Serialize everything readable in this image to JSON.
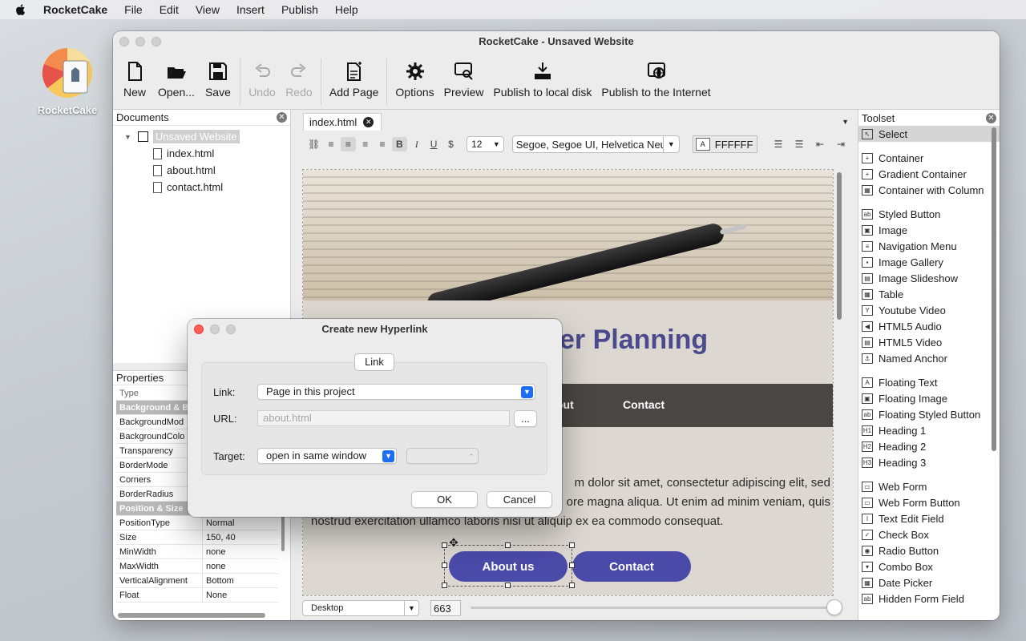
{
  "menubar": {
    "app_name": "RocketCake",
    "items": [
      "File",
      "Edit",
      "View",
      "Insert",
      "Publish",
      "Help"
    ]
  },
  "desktop_icon": {
    "label": "RocketCake"
  },
  "window": {
    "title": "RocketCake - Unsaved Website"
  },
  "toolbar": {
    "new": "New",
    "open": "Open...",
    "save": "Save",
    "undo": "Undo",
    "redo": "Redo",
    "add_page": "Add Page",
    "options": "Options",
    "preview": "Preview",
    "publish_local": "Publish to local disk",
    "publish_internet": "Publish to the Internet"
  },
  "documents": {
    "title": "Documents",
    "root": "Unsaved Website",
    "files": [
      "index.html",
      "about.html",
      "contact.html"
    ]
  },
  "properties": {
    "title": "Properties",
    "rows": [
      {
        "k": "Type",
        "v": "",
        "kind": "hdr"
      },
      {
        "k": "Background & Bo",
        "v": "",
        "kind": "group"
      },
      {
        "k": "BackgroundMod",
        "v": "",
        "kind": "row"
      },
      {
        "k": "BackgroundColo",
        "v": "",
        "kind": "row"
      },
      {
        "k": "Transparency",
        "v": "",
        "kind": "row"
      },
      {
        "k": "BorderMode",
        "v": "",
        "kind": "row"
      },
      {
        "k": "Corners",
        "v": "",
        "kind": "row"
      },
      {
        "k": "BorderRadius",
        "v": "",
        "kind": "row"
      },
      {
        "k": "Position & Size",
        "v": "",
        "kind": "group"
      },
      {
        "k": "PositionType",
        "v": "Normal",
        "kind": "row"
      },
      {
        "k": "Size",
        "v": "150, 40",
        "kind": "row"
      },
      {
        "k": "MinWidth",
        "v": "none",
        "kind": "row"
      },
      {
        "k": "MaxWidth",
        "v": "none",
        "kind": "row"
      },
      {
        "k": "VerticalAlignment",
        "v": "Bottom",
        "kind": "row"
      },
      {
        "k": "Float",
        "v": "None",
        "kind": "row"
      }
    ]
  },
  "editor": {
    "tab": "index.html",
    "font_size": "12",
    "font_name": "Segoe, Segoe UI, Helvetica Neu",
    "color_value": "FFFFFF",
    "color_swatch_glyph": "A",
    "banner_heading": "er Planning",
    "nav_items": [
      "out",
      "Contact"
    ],
    "paragraph_lines": [
      "m dolor sit amet, consectetur adipiscing elit, sed",
      "ore magna aliqua. Ut enim ad minim veniam, quis",
      "nostrud exercitation ullamco laboris nisi ut aliquip ex ea commodo consequat."
    ],
    "button_about": "About us",
    "button_contact": "Contact",
    "device": "Desktop",
    "width_value": "663"
  },
  "toolset": {
    "title": "Toolset",
    "groups": [
      [
        {
          "label": "Select",
          "icon": "cursor-icon",
          "glyph": "↖"
        }
      ],
      [
        {
          "label": "Container",
          "icon": "container-icon",
          "glyph": "+"
        },
        {
          "label": "Gradient Container",
          "icon": "gradient-container-icon",
          "glyph": "+"
        },
        {
          "label": "Container with Column",
          "icon": "column-container-icon",
          "glyph": "▦"
        }
      ],
      [
        {
          "label": "Styled Button",
          "icon": "styled-button-icon",
          "glyph": "ab"
        },
        {
          "label": "Image",
          "icon": "image-icon",
          "glyph": "▣"
        },
        {
          "label": "Navigation Menu",
          "icon": "navigation-menu-icon",
          "glyph": "≡"
        },
        {
          "label": "Image Gallery",
          "icon": "image-gallery-icon",
          "glyph": "▪"
        },
        {
          "label": "Image Slideshow",
          "icon": "image-slideshow-icon",
          "glyph": "▤"
        },
        {
          "label": "Table",
          "icon": "table-icon",
          "glyph": "▦"
        },
        {
          "label": "Youtube Video",
          "icon": "youtube-icon",
          "glyph": "Y"
        },
        {
          "label": "HTML5 Audio",
          "icon": "audio-icon",
          "glyph": "◀"
        },
        {
          "label": "HTML5 Video",
          "icon": "video-icon",
          "glyph": "▤"
        },
        {
          "label": "Named Anchor",
          "icon": "anchor-icon",
          "glyph": "⚓"
        }
      ],
      [
        {
          "label": "Floating Text",
          "icon": "floating-text-icon",
          "glyph": "A"
        },
        {
          "label": "Floating Image",
          "icon": "floating-image-icon",
          "glyph": "▣"
        },
        {
          "label": "Floating Styled Button",
          "icon": "floating-button-icon",
          "glyph": "ab"
        },
        {
          "label": "Heading 1",
          "icon": "heading1-icon",
          "glyph": "H1"
        },
        {
          "label": "Heading 2",
          "icon": "heading2-icon",
          "glyph": "H2"
        },
        {
          "label": "Heading 3",
          "icon": "heading3-icon",
          "glyph": "H3"
        }
      ],
      [
        {
          "label": "Web Form",
          "icon": "web-form-icon",
          "glyph": "▭"
        },
        {
          "label": "Web Form Button",
          "icon": "form-button-icon",
          "glyph": "▭"
        },
        {
          "label": "Text Edit Field",
          "icon": "text-field-icon",
          "glyph": "I"
        },
        {
          "label": "Check Box",
          "icon": "checkbox-icon",
          "glyph": "✓"
        },
        {
          "label": "Radio Button",
          "icon": "radio-icon",
          "glyph": "◉"
        },
        {
          "label": "Combo Box",
          "icon": "combobox-icon",
          "glyph": "▾"
        },
        {
          "label": "Date Picker",
          "icon": "date-picker-icon",
          "glyph": "▦"
        },
        {
          "label": "Hidden Form Field",
          "icon": "hidden-field-icon",
          "glyph": "ab"
        }
      ]
    ]
  },
  "dialog": {
    "title": "Create new Hyperlink",
    "segment": "Link",
    "link_label": "Link:",
    "link_value": "Page in this project",
    "url_label": "URL:",
    "url_value": "about.html",
    "browse": "...",
    "target_label": "Target:",
    "target_value": "open in same window",
    "ok": "OK",
    "cancel": "Cancel"
  },
  "colors": {
    "accent": "#1e6ef5",
    "button_blue": "#4a4aa8",
    "nav_dark": "#4a4644",
    "close_red": "#fe5f57"
  }
}
